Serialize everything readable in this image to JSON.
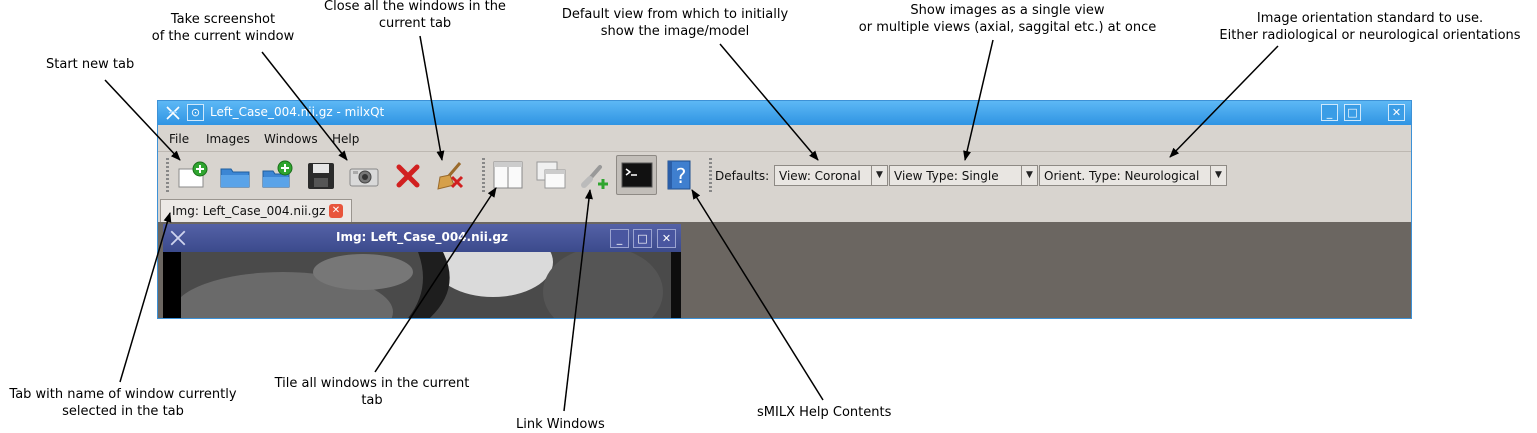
{
  "annotations": {
    "start_new_tab": "Start new tab",
    "screenshot": [
      "Take screenshot",
      "of the current window"
    ],
    "close_all": [
      "Close all the windows in the",
      "current tab"
    ],
    "default_view": [
      "Default view from which to initially",
      "show the image/model"
    ],
    "view_type": [
      "Show images as a single view",
      "or multiple views (axial, saggital etc.) at once"
    ],
    "orientation": [
      "Image orientation standard to use.",
      "Either radiological or neurological orientations"
    ],
    "tab_name": [
      "Tab with name of window currently",
      "selected in the tab"
    ],
    "tile": [
      "Tile all windows in the current",
      "tab"
    ],
    "link": "Link Windows",
    "help": "sMILX Help Contents"
  },
  "window": {
    "title": "Left_Case_004.nii.gz - milxQt",
    "accent_color": "#3d91d6"
  },
  "menu": [
    "File",
    "Images",
    "Windows",
    "Help"
  ],
  "toolbar": {
    "icons": [
      "new-tab-icon",
      "open-folder-icon",
      "add-folder-icon",
      "save-icon",
      "camera-icon",
      "close-icon",
      "broom-icon",
      "tile-windows-icon",
      "cascade-windows-icon",
      "link-windows-icon",
      "console-icon",
      "help-book-icon"
    ],
    "defaults_label": "Defaults:",
    "view": "View: Coronal",
    "view_type": "View Type: Single",
    "orient_type": "Orient. Type: Neurological"
  },
  "tab": {
    "label": "Img: Left_Case_004.nii.gz"
  },
  "subwindow": {
    "title": "Img: Left_Case_004.nii.gz"
  }
}
